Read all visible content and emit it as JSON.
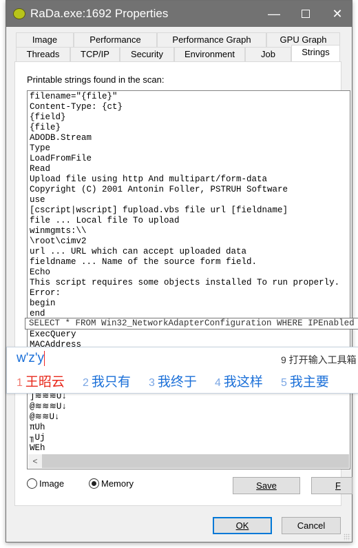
{
  "window": {
    "title": "RaDa.exe:1692 Properties",
    "minimize_icon": "minimize-icon",
    "maximize_icon": "maximize-icon",
    "close_icon": "close-icon"
  },
  "tabs": {
    "row1": [
      "Image",
      "Performance",
      "Performance Graph",
      "GPU Graph"
    ],
    "row2": [
      "Threads",
      "TCP/IP",
      "Security",
      "Environment",
      "Job",
      "Strings"
    ],
    "active": "Strings"
  },
  "strings_panel": {
    "caption": "Printable strings found in the scan:",
    "lines": [
      "filename=\"{file}\"",
      "Content-Type: {ct}",
      "{field}",
      "{file}",
      "ADODB.Stream",
      "Type",
      "LoadFromFile",
      "Read",
      "Upload file using http And multipart/form-data",
      "Copyright (C) 2001 Antonin Foller, PSTRUH Software",
      "use",
      "[cscript|wscript] fupload.vbs file url [fieldname]",
      "file ... Local file To upload",
      "winmgmts:\\\\",
      "\\root\\cimv2",
      "url ... URL which can accept uploaded data",
      "fieldname ... Name of the source form field.",
      "Echo",
      "This script requires some objects installed To run properly.",
      "Error:",
      "begin",
      "end"
    ],
    "lines_after": [
      "ExecQuery",
      "MACAddress"
    ],
    "lines_bottom": [
      "]≋≋≋U↓",
      "@≋≋≋U↓",
      "@≋≋U↓",
      "πUh",
      "╖Uj",
      "WEh"
    ],
    "tooltip": "SELECT * FROM Win32_NetworkAdapterConfiguration WHERE IPEnabled = True",
    "radio_image": "Image",
    "radio_memory": "Memory",
    "selected_source": "Memory",
    "save_button": "Save",
    "find_button": "F"
  },
  "ime": {
    "composition": "w'z'y",
    "toolbox": "9 打开输入工具箱",
    "candidates": [
      {
        "n": "1",
        "t": "王昭云"
      },
      {
        "n": "2",
        "t": "我只有"
      },
      {
        "n": "3",
        "t": "我终于"
      },
      {
        "n": "4",
        "t": "我这样"
      },
      {
        "n": "5",
        "t": "我主要"
      }
    ],
    "accent": "#1a6fd8",
    "selected_color": "#e8291c"
  },
  "footer": {
    "ok": "OK",
    "cancel": "Cancel"
  }
}
